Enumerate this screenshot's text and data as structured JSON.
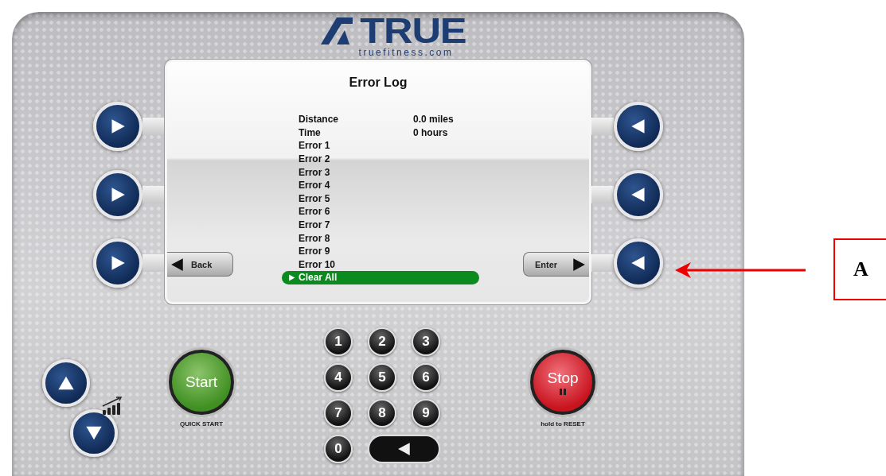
{
  "header": {
    "brand": "TRUE",
    "website": "truefitness.com"
  },
  "display": {
    "title": "Error Log",
    "back_button": "Back",
    "enter_button": "Enter",
    "rows": [
      {
        "label": "Distance",
        "value": "0.0 miles",
        "selected": false
      },
      {
        "label": "Time",
        "value": "0 hours",
        "selected": false
      },
      {
        "label": "Error 1",
        "selected": false
      },
      {
        "label": "Error 2",
        "selected": false
      },
      {
        "label": "Error 3",
        "selected": false
      },
      {
        "label": "Error 4",
        "selected": false
      },
      {
        "label": "Error 5",
        "selected": false
      },
      {
        "label": "Error 6",
        "selected": false
      },
      {
        "label": "Error 7",
        "selected": false
      },
      {
        "label": "Error 8",
        "selected": false
      },
      {
        "label": "Error 9",
        "selected": false
      },
      {
        "label": "Error 10",
        "selected": false
      },
      {
        "label": "Clear All",
        "selected": true
      }
    ]
  },
  "keypad": {
    "keys": [
      "1",
      "2",
      "3",
      "4",
      "5",
      "6",
      "7",
      "8",
      "9",
      "0"
    ]
  },
  "start_button": {
    "label": "Start",
    "caption": "QUICK START"
  },
  "stop_button": {
    "label": "Stop",
    "caption": "hold to RESET"
  },
  "callout": {
    "label": "A"
  }
}
